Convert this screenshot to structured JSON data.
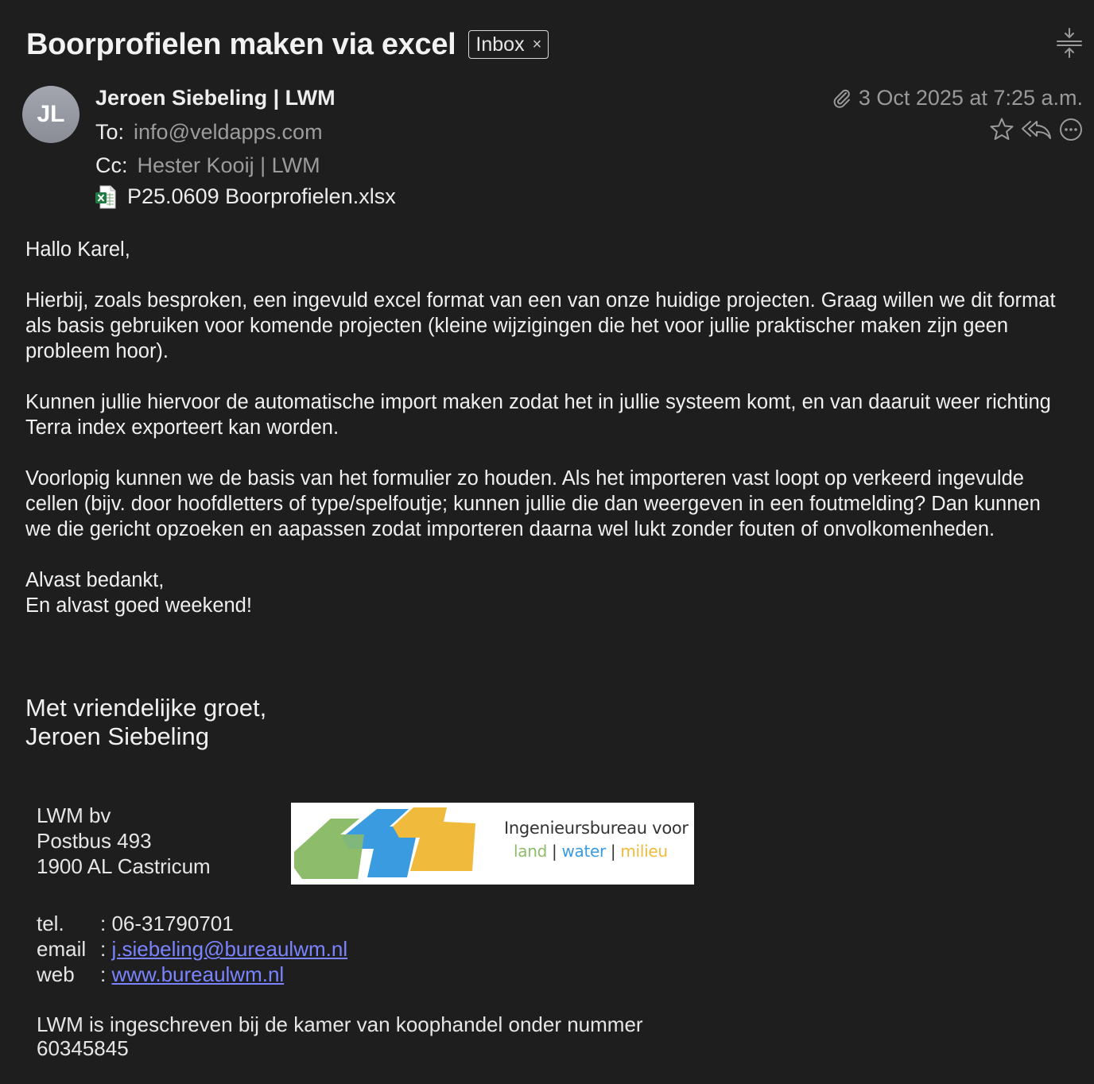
{
  "header": {
    "subject": "Boorprofielen maken via excel",
    "mailbox_badge": "Inbox",
    "badge_close": "×"
  },
  "message": {
    "avatar_initials": "JL",
    "sender": "Jeroen Siebeling | LWM",
    "to_label": "To:",
    "to_value": "info@veldapps.com",
    "cc_label": "Cc:",
    "cc_value": "Hester Kooij | LWM",
    "attachment_name": "P25.0609 Boorprofielen.xlsx",
    "date": "3 Oct 2025 at 7:25 a.m."
  },
  "body": {
    "greeting": "Hallo Karel,",
    "paragraph1": "Hierbij, zoals besproken, een ingevuld excel format van een van onze huidige projecten. Graag willen we dit format als basis gebruiken voor komende projecten (kleine wijzigingen die het voor jullie praktischer maken zijn geen probleem hoor).",
    "paragraph2": "Kunnen jullie hiervoor de automatische import maken zodat het in jullie systeem komt, en van daaruit weer richting Terra index exporteert kan worden.",
    "paragraph3": "Voorlopig kunnen we de basis van het formulier zo houden. Als het importeren vast loopt op verkeerd ingevulde cellen (bijv. door hoofdletters of type/spelfoutje; kunnen jullie die dan weergeven in een foutmelding? Dan kunnen we die gericht opzoeken en aapassen zodat importeren daarna wel lukt zonder fouten of onvolkomenheden.",
    "closing1": "Alvast bedankt,",
    "closing2": "En alvast goed weekend!"
  },
  "signature": {
    "regards": "Met vriendelijke groet,",
    "name": "Jeroen Siebeling",
    "company": "LWM bv",
    "po_box": "Postbus 493",
    "city": "1900 AL Castricum",
    "logo_tagline": "Ingenieursbureau voor",
    "logo_land": "land",
    "logo_water": "water",
    "logo_milieu": "milieu",
    "tel_label": "tel.",
    "tel_value": ": 06-31790701",
    "email_label": "email",
    "email_sep": ": ",
    "email_value": "j.siebeling@bureaulwm.nl",
    "web_label": "web",
    "web_sep": ": ",
    "web_value": "www.bureaulwm.nl",
    "kvk": "LWM is ingeschreven bij de kamer van koophandel onder nummer 60345845"
  },
  "colors": {
    "background": "#1e1e1e",
    "link": "#7b84ff",
    "logo_green": "#8dbd6a",
    "logo_blue": "#3a9be0",
    "logo_yellow": "#f0bb3c"
  }
}
